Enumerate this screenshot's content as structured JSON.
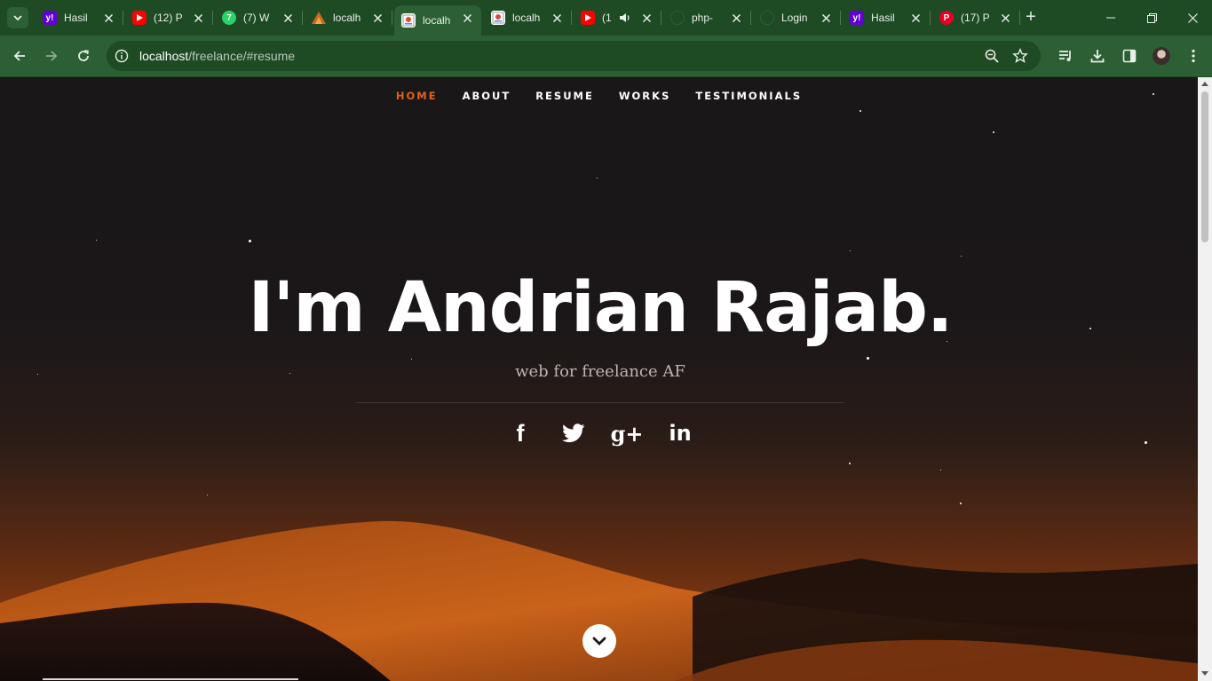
{
  "browser": {
    "tabs": [
      {
        "title": "Hasil",
        "favicon": "yahoo-icon",
        "color": "#6001d2"
      },
      {
        "title": "(12) P",
        "favicon": "youtube-icon",
        "color": "#ff0000"
      },
      {
        "title": "(7) W",
        "favicon": "whatsapp-icon",
        "color": "#25d366"
      },
      {
        "title": "localh",
        "favicon": "xampp-icon",
        "color": "#fb7a24"
      },
      {
        "title": "localh",
        "favicon": "page-icon",
        "color": "#ffffff",
        "active": true
      },
      {
        "title": "localh",
        "favicon": "page-icon",
        "color": "#ffffff"
      },
      {
        "title": "(1",
        "favicon": "youtube-icon",
        "color": "#ff0000",
        "audio": true
      },
      {
        "title": "php-",
        "favicon": "github-icon",
        "color": "#1e4a24"
      },
      {
        "title": "Login",
        "favicon": "github-icon",
        "color": "#1e4a24"
      },
      {
        "title": "Hasil",
        "favicon": "yahoo-icon",
        "color": "#6001d2"
      },
      {
        "title": "(17) P",
        "favicon": "pinterest-icon",
        "color": "#e60023"
      }
    ],
    "url_host": "localhost",
    "url_path": "/freelance/#resume"
  },
  "site": {
    "nav": [
      {
        "label": "HOME",
        "current": true
      },
      {
        "label": "ABOUT"
      },
      {
        "label": "RESUME"
      },
      {
        "label": "WORKS"
      },
      {
        "label": "TESTIMONIALS"
      }
    ],
    "title": "I'm Andrian Rajab.",
    "subtitle": "web for freelance AF",
    "social": [
      {
        "icon": "facebook-icon",
        "glyph": "f"
      },
      {
        "icon": "twitter-icon",
        "glyph": ""
      },
      {
        "icon": "google-plus-icon",
        "glyph": "g+"
      },
      {
        "icon": "linkedin-icon",
        "glyph": "in"
      }
    ],
    "accent_color": "#e0611f"
  }
}
